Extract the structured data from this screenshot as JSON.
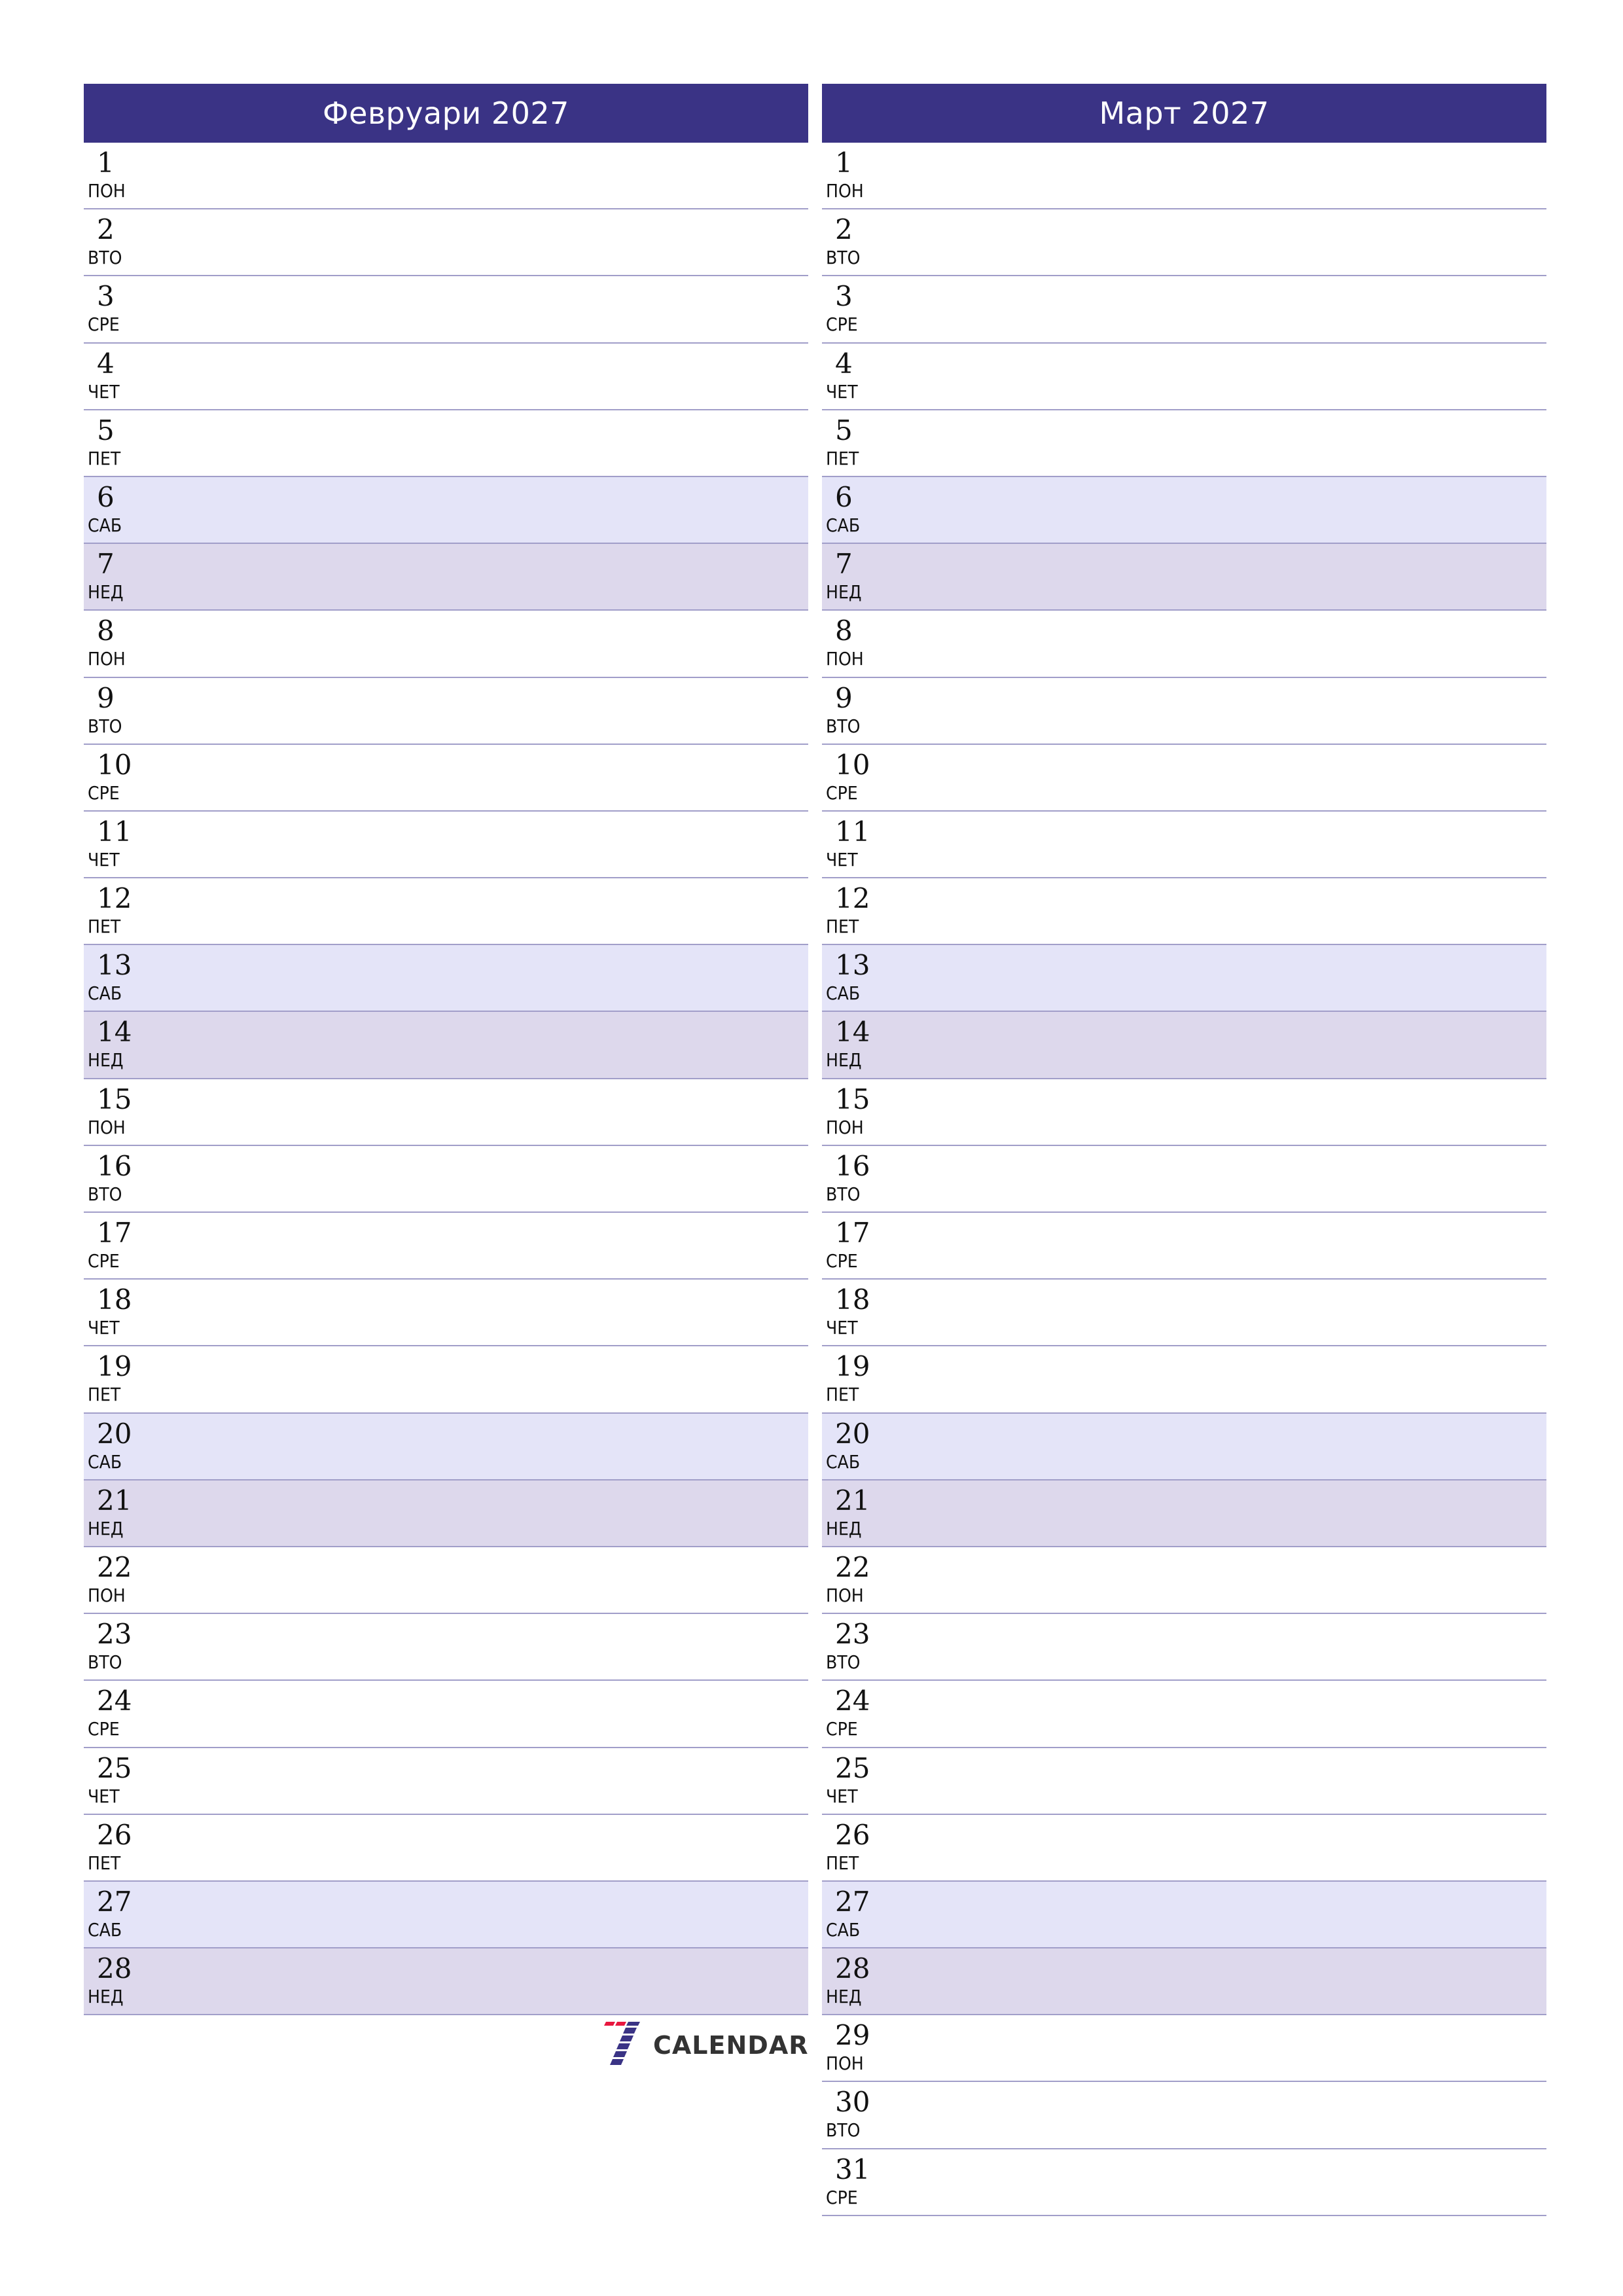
{
  "colors": {
    "header_bg": "#3a3385",
    "saturday_bg": "#e4e4f8",
    "sunday_bg": "#ddd8ec",
    "divider": "#a19ec9",
    "logo_red": "#e8173f",
    "logo_blue": "#3a3385"
  },
  "months": [
    {
      "title": "Февруари 2027",
      "days": [
        {
          "n": "1",
          "wd": "ПОН",
          "type": "weekday"
        },
        {
          "n": "2",
          "wd": "ВТО",
          "type": "weekday"
        },
        {
          "n": "3",
          "wd": "СРЕ",
          "type": "weekday"
        },
        {
          "n": "4",
          "wd": "ЧЕТ",
          "type": "weekday"
        },
        {
          "n": "5",
          "wd": "ПЕТ",
          "type": "weekday"
        },
        {
          "n": "6",
          "wd": "САБ",
          "type": "sat"
        },
        {
          "n": "7",
          "wd": "НЕД",
          "type": "sun"
        },
        {
          "n": "8",
          "wd": "ПОН",
          "type": "weekday"
        },
        {
          "n": "9",
          "wd": "ВТО",
          "type": "weekday"
        },
        {
          "n": "10",
          "wd": "СРЕ",
          "type": "weekday"
        },
        {
          "n": "11",
          "wd": "ЧЕТ",
          "type": "weekday"
        },
        {
          "n": "12",
          "wd": "ПЕТ",
          "type": "weekday"
        },
        {
          "n": "13",
          "wd": "САБ",
          "type": "sat"
        },
        {
          "n": "14",
          "wd": "НЕД",
          "type": "sun"
        },
        {
          "n": "15",
          "wd": "ПОН",
          "type": "weekday"
        },
        {
          "n": "16",
          "wd": "ВТО",
          "type": "weekday"
        },
        {
          "n": "17",
          "wd": "СРЕ",
          "type": "weekday"
        },
        {
          "n": "18",
          "wd": "ЧЕТ",
          "type": "weekday"
        },
        {
          "n": "19",
          "wd": "ПЕТ",
          "type": "weekday"
        },
        {
          "n": "20",
          "wd": "САБ",
          "type": "sat"
        },
        {
          "n": "21",
          "wd": "НЕД",
          "type": "sun"
        },
        {
          "n": "22",
          "wd": "ПОН",
          "type": "weekday"
        },
        {
          "n": "23",
          "wd": "ВТО",
          "type": "weekday"
        },
        {
          "n": "24",
          "wd": "СРЕ",
          "type": "weekday"
        },
        {
          "n": "25",
          "wd": "ЧЕТ",
          "type": "weekday"
        },
        {
          "n": "26",
          "wd": "ПЕТ",
          "type": "weekday"
        },
        {
          "n": "27",
          "wd": "САБ",
          "type": "sat"
        },
        {
          "n": "28",
          "wd": "НЕД",
          "type": "sun"
        }
      ]
    },
    {
      "title": "Март 2027",
      "days": [
        {
          "n": "1",
          "wd": "ПОН",
          "type": "weekday"
        },
        {
          "n": "2",
          "wd": "ВТО",
          "type": "weekday"
        },
        {
          "n": "3",
          "wd": "СРЕ",
          "type": "weekday"
        },
        {
          "n": "4",
          "wd": "ЧЕТ",
          "type": "weekday"
        },
        {
          "n": "5",
          "wd": "ПЕТ",
          "type": "weekday"
        },
        {
          "n": "6",
          "wd": "САБ",
          "type": "sat"
        },
        {
          "n": "7",
          "wd": "НЕД",
          "type": "sun"
        },
        {
          "n": "8",
          "wd": "ПОН",
          "type": "weekday"
        },
        {
          "n": "9",
          "wd": "ВТО",
          "type": "weekday"
        },
        {
          "n": "10",
          "wd": "СРЕ",
          "type": "weekday"
        },
        {
          "n": "11",
          "wd": "ЧЕТ",
          "type": "weekday"
        },
        {
          "n": "12",
          "wd": "ПЕТ",
          "type": "weekday"
        },
        {
          "n": "13",
          "wd": "САБ",
          "type": "sat"
        },
        {
          "n": "14",
          "wd": "НЕД",
          "type": "sun"
        },
        {
          "n": "15",
          "wd": "ПОН",
          "type": "weekday"
        },
        {
          "n": "16",
          "wd": "ВТО",
          "type": "weekday"
        },
        {
          "n": "17",
          "wd": "СРЕ",
          "type": "weekday"
        },
        {
          "n": "18",
          "wd": "ЧЕТ",
          "type": "weekday"
        },
        {
          "n": "19",
          "wd": "ПЕТ",
          "type": "weekday"
        },
        {
          "n": "20",
          "wd": "САБ",
          "type": "sat"
        },
        {
          "n": "21",
          "wd": "НЕД",
          "type": "sun"
        },
        {
          "n": "22",
          "wd": "ПОН",
          "type": "weekday"
        },
        {
          "n": "23",
          "wd": "ВТО",
          "type": "weekday"
        },
        {
          "n": "24",
          "wd": "СРЕ",
          "type": "weekday"
        },
        {
          "n": "25",
          "wd": "ЧЕТ",
          "type": "weekday"
        },
        {
          "n": "26",
          "wd": "ПЕТ",
          "type": "weekday"
        },
        {
          "n": "27",
          "wd": "САБ",
          "type": "sat"
        },
        {
          "n": "28",
          "wd": "НЕД",
          "type": "sun"
        },
        {
          "n": "29",
          "wd": "ПОН",
          "type": "weekday"
        },
        {
          "n": "30",
          "wd": "ВТО",
          "type": "weekday"
        },
        {
          "n": "31",
          "wd": "СРЕ",
          "type": "weekday"
        }
      ]
    }
  ],
  "logo": {
    "icon": "seven-logo-icon",
    "text": "CALENDAR"
  }
}
